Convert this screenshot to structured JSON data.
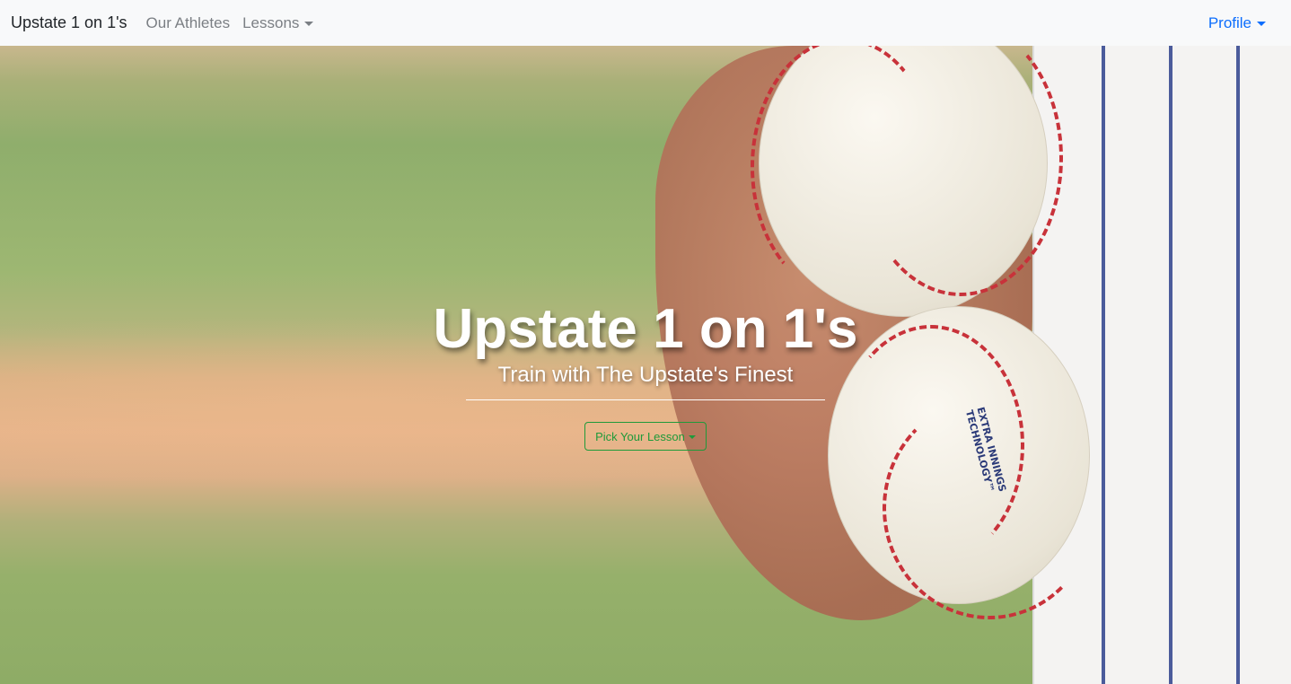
{
  "navbar": {
    "brand": "Upstate 1 on 1's",
    "links": [
      {
        "label": "Our Athletes"
      },
      {
        "label": "Lessons"
      }
    ],
    "profile_label": "Profile"
  },
  "hero": {
    "title": "Upstate 1 on 1's",
    "subtitle": "Train with The Upstate's Finest",
    "button_label": "Pick Your Lesson",
    "ball_label": "EXTRA INNINGS TECHNOLOGY™"
  },
  "colors": {
    "navbar_bg": "#f8f9fa",
    "profile_link": "#0d6efd",
    "button_border": "#1f9a3a"
  }
}
